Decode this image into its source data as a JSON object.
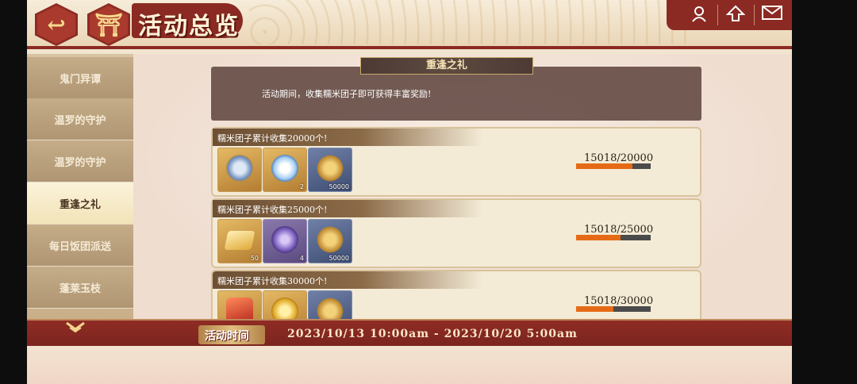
{
  "header": {
    "title": "活动总览",
    "back_icon": "↩",
    "home_icon": "⛩"
  },
  "top_right": {
    "icons": [
      "character-icon",
      "up-icon",
      "mail-icon"
    ]
  },
  "sidebar": {
    "items": [
      {
        "label": "鬼门异谭"
      },
      {
        "label": "温罗的守护"
      },
      {
        "label": "温罗的守护"
      },
      {
        "label": "重逢之礼"
      },
      {
        "label": "每日饭团派送"
      },
      {
        "label": "蓬莱玉枝"
      }
    ],
    "active_index": 3
  },
  "main": {
    "subtitle": "重逢之礼",
    "description": "活动期间，收集糯米团子即可获得丰富奖励!",
    "rewards": [
      {
        "title": "糯米团子累计收集20000个!",
        "progress_text": "15018/20000",
        "progress_fraction": 0.751,
        "items": [
          {
            "icon": "mirror-item",
            "count": ""
          },
          {
            "icon": "crystal-item",
            "count": "2"
          },
          {
            "icon": "coins-item",
            "count": "50000"
          }
        ]
      },
      {
        "title": "糯米团子累计收集25000个!",
        "progress_text": "15018/25000",
        "progress_fraction": 0.601,
        "items": [
          {
            "icon": "gold-bar-item",
            "count": "50"
          },
          {
            "icon": "orb-item",
            "count": "4"
          },
          {
            "icon": "coins-item",
            "count": "50000"
          }
        ]
      },
      {
        "title": "糯米团子累计收集30000个!",
        "progress_text": "15018/30000",
        "progress_fraction": 0.501,
        "items": [
          {
            "icon": "red-gem-item",
            "count": ""
          },
          {
            "icon": "gold-coin-item",
            "count": ""
          },
          {
            "icon": "coins-item",
            "count": ""
          }
        ]
      }
    ]
  },
  "footer": {
    "time_label": "活动时间",
    "time_range": "2023/10/13 10:00am - 2023/10/20 5:00am"
  }
}
